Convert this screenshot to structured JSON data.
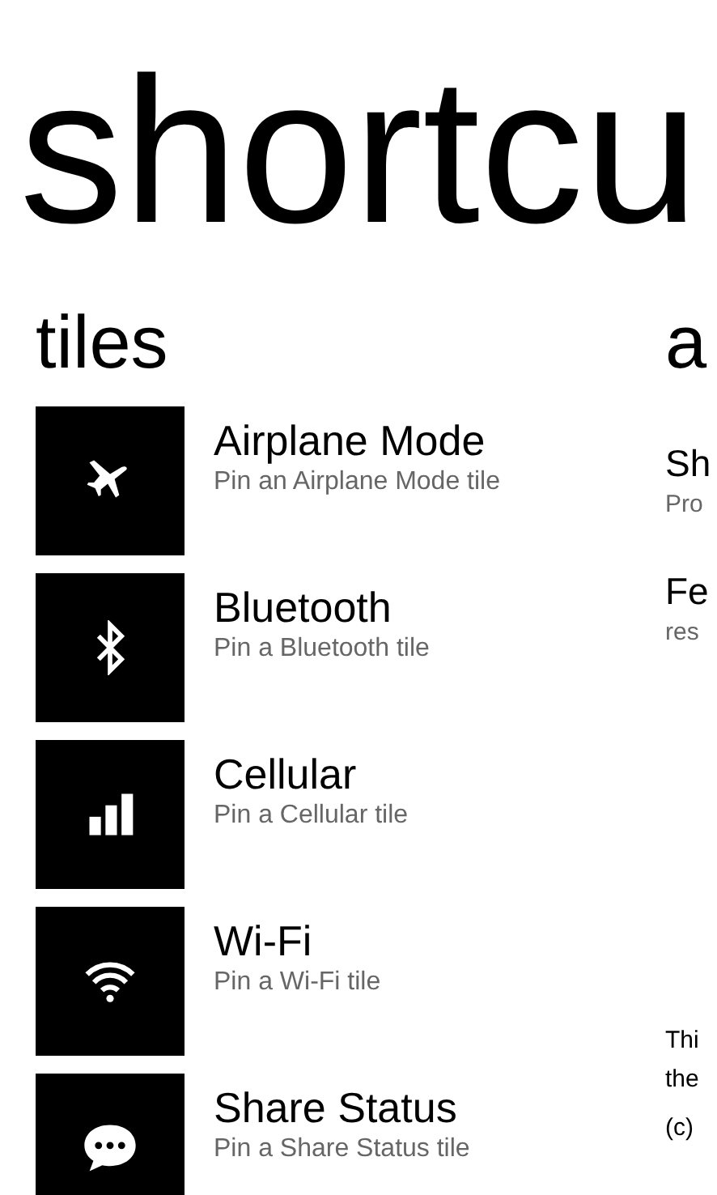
{
  "title": "shortcu",
  "tiles_section": {
    "heading": "tiles",
    "items": [
      {
        "title": "Airplane Mode",
        "subtitle": "Pin an Airplane Mode tile"
      },
      {
        "title": "Bluetooth",
        "subtitle": "Pin a Bluetooth tile"
      },
      {
        "title": "Cellular",
        "subtitle": "Pin a Cellular tile"
      },
      {
        "title": "Wi-Fi",
        "subtitle": "Pin a Wi-Fi tile"
      },
      {
        "title": "Share Status",
        "subtitle": "Pin a Share Status tile"
      }
    ]
  },
  "about_section": {
    "heading": "a",
    "items": [
      {
        "title": "Sh",
        "subtitle": "Pro"
      },
      {
        "title": "Fe",
        "subtitle": "res"
      }
    ],
    "notes": [
      "Thi",
      "the",
      "(c)"
    ]
  }
}
